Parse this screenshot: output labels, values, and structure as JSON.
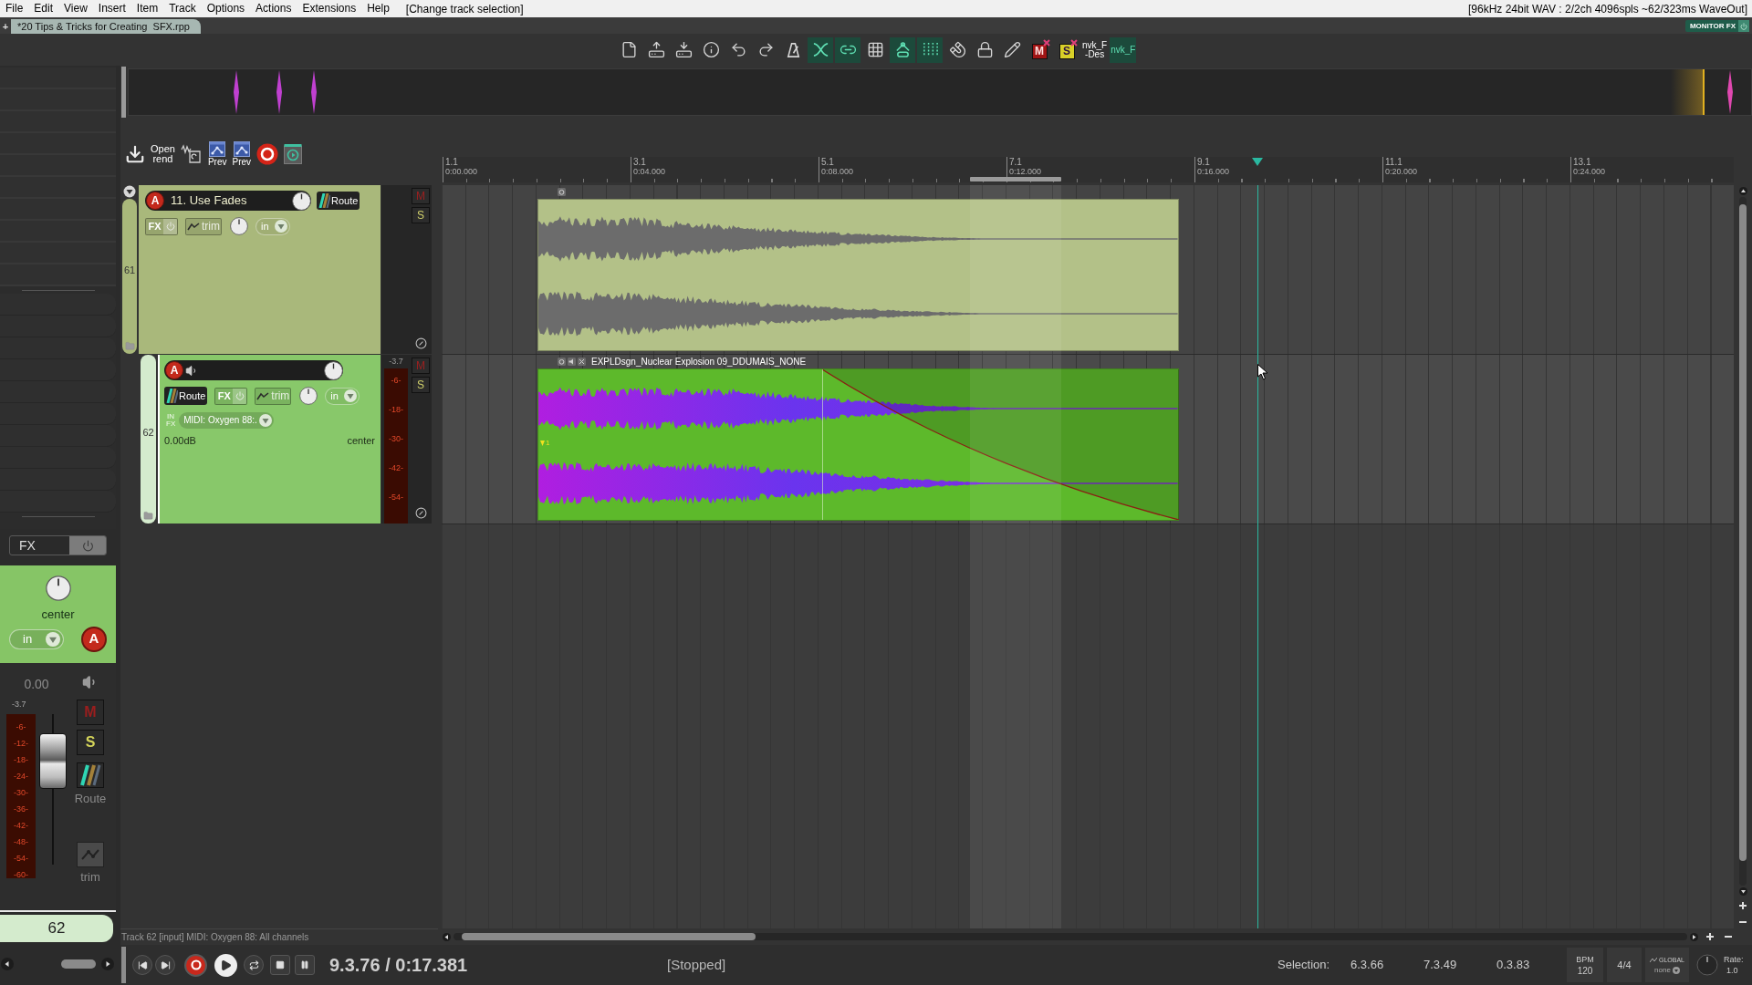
{
  "menu_bar": {
    "items": [
      "File",
      "Edit",
      "View",
      "Insert",
      "Item",
      "Track",
      "Options",
      "Actions",
      "Extensions",
      "Help"
    ],
    "action_hint": "[Change track selection]",
    "audio_status": "[96kHz 24bit WAV : 2/2ch 4096spls ~62/323ms WaveOut]"
  },
  "project_tabs": {
    "new_tab": "+",
    "tabs": [
      {
        "label": "*20 Tips & Tricks for Creating  SFX.rpp",
        "selected": true
      }
    ],
    "monitor_fx": "MONITOR FX"
  },
  "main_toolbar": [
    {
      "kind": "icon",
      "active": false
    },
    {
      "kind": "icon",
      "active": false
    },
    {
      "kind": "icon",
      "active": false
    },
    {
      "kind": "icon",
      "active": false
    },
    {
      "kind": "icon",
      "active": false
    },
    {
      "kind": "icon",
      "active": false
    },
    {
      "kind": "icon",
      "active": false
    },
    {
      "kind": "icon",
      "active": true
    },
    {
      "kind": "icon",
      "active": true
    },
    {
      "kind": "icon",
      "active": false
    },
    {
      "kind": "icon",
      "active": true
    },
    {
      "kind": "icon",
      "active": true
    },
    {
      "kind": "icon",
      "active": false
    },
    {
      "kind": "icon",
      "active": false
    },
    {
      "kind": "icon",
      "active": false
    },
    {
      "kind": "badge",
      "label": "M",
      "color": "#a01414",
      "active": false
    },
    {
      "kind": "badge",
      "label": "S",
      "color": "#d8d028",
      "active": false
    },
    {
      "kind": "text",
      "label": "nvk_F -Des",
      "active": false
    },
    {
      "kind": "text",
      "label": "nvk_F",
      "active": true
    }
  ],
  "track_toolbar": [
    {
      "kind": "icon"
    },
    {
      "kind": "text",
      "label": "Open rend"
    },
    {
      "kind": "icon"
    },
    {
      "kind": "icon_text",
      "label": "Prev"
    },
    {
      "kind": "icon_text",
      "label": "Prev"
    },
    {
      "kind": "icon"
    },
    {
      "kind": "icon"
    }
  ],
  "tracks": [
    {
      "number": "61",
      "name": "11. Use Fades",
      "color": "#a9b87b",
      "selected": false,
      "monitoring": false,
      "rec_arm": "A",
      "route": "Route",
      "fx": "FX",
      "trim": "trim",
      "input": "in",
      "mute": "M",
      "solo": "S",
      "items": [
        {
          "kind": "waveform",
          "color": "#b3c188",
          "fade_out": false
        }
      ],
      "children": [
        {
          "number": "62",
          "color": "#88c86a",
          "selected": true,
          "monitoring": true,
          "rec_arm": "A",
          "route": "Route",
          "fx": "FX",
          "trim": "trim",
          "input": "in",
          "mute": "M",
          "solo": "S",
          "input_fx": "IN FX",
          "midi_input": "MIDI: Oxygen 88:.",
          "volume": "0.00dB",
          "pan": "center",
          "meter": {
            "peak": "-3.7",
            "scale": [
              "-6-",
              "-18-",
              "-30-",
              "-42-",
              "-54-"
            ]
          },
          "items": [
            {
              "kind": "spectral",
              "name": "EXPLDsgn_Nuclear Explosion 09_DDUMAIS_NONE",
              "color": "#5db92b",
              "fade_out": true,
              "take_marker": "1"
            }
          ]
        }
      ]
    }
  ],
  "ruler": [
    {
      "measure": "1.1",
      "time": "0:00.000"
    },
    {
      "measure": "3.1",
      "time": "0:04.000"
    },
    {
      "measure": "5.1",
      "time": "0:08.000"
    },
    {
      "measure": "7.1",
      "time": "0:12.000"
    },
    {
      "measure": "9.1",
      "time": "0:16.000"
    },
    {
      "measure": "11.1",
      "time": "0:20.000"
    },
    {
      "measure": "13.1",
      "time": "0:24.000"
    }
  ],
  "mixer_strip": {
    "fx": "FX",
    "pan": "center",
    "input": "in",
    "rec_arm": "A",
    "volume": "0.00",
    "peak": "-3.7",
    "meter_scale": [
      "-6-",
      "-12-",
      "-18-",
      "-24-",
      "-30-",
      "-36-",
      "-42-",
      "-48-",
      "-54-",
      "-60-"
    ],
    "fader": {
      "level": 0.79
    },
    "mute": "M",
    "solo": "S",
    "route": "Route",
    "trim": "trim",
    "number": "62"
  },
  "status_text": "Track 62 [input] MIDI: Oxygen 88: All channels",
  "transport": {
    "position": "9.3.76 / 0:17.381",
    "state": "[Stopped]",
    "selection_label": "Selection:",
    "selection": [
      "6.3.66",
      "7.3.49",
      "0.3.83"
    ],
    "bpm_label": "BPM",
    "bpm": "120",
    "time_signature": "4/4",
    "playrate_mode": "GLOBAL",
    "playrate_option": "none",
    "rate_label": "Rate:",
    "rate": "1.0"
  }
}
